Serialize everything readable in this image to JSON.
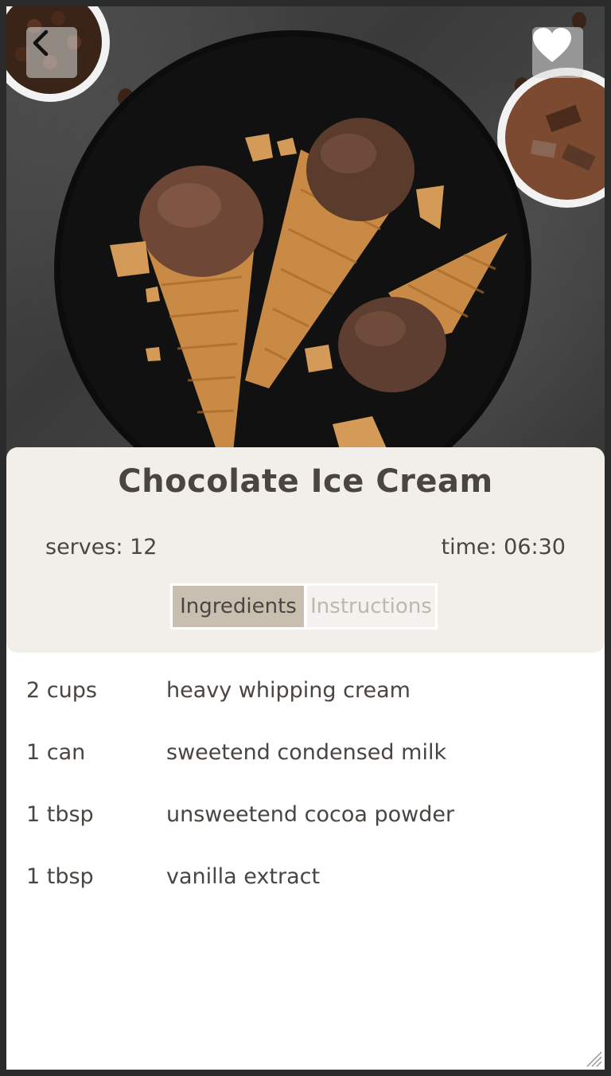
{
  "recipe": {
    "title": "Chocolate Ice Cream",
    "serves_label": "serves: 12",
    "time_label": "time: 06:30"
  },
  "header": {
    "back_icon": "chevron-left-icon",
    "favorite_icon": "heart-icon"
  },
  "tabs": [
    {
      "label": "Ingredients",
      "active": true
    },
    {
      "label": "Instructions",
      "active": false
    }
  ],
  "ingredients": [
    {
      "qty": "2 cups",
      "name": "heavy whipping cream"
    },
    {
      "qty": "1 can",
      "name": "sweetend condensed milk"
    },
    {
      "qty": "1 tbsp",
      "name": "unsweetend cocoa powder"
    },
    {
      "qty": "1 tbsp",
      "name": "vanilla extract"
    }
  ],
  "colors": {
    "card_bg": "#f2efeb",
    "active_tab": "#c8bfb1",
    "text": "#4a4540"
  }
}
